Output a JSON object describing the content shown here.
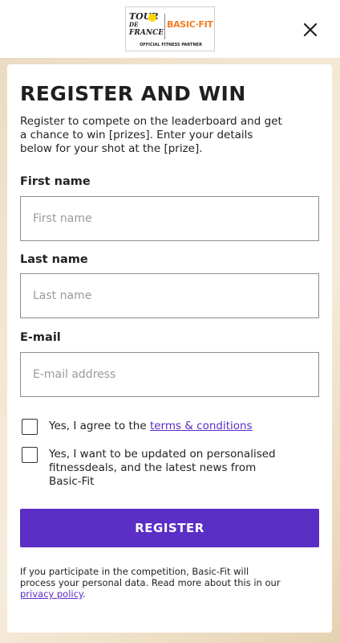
{
  "header": {
    "logo": {
      "tdf_text_1": "TOUR",
      "tdf_text_2": "DE",
      "tdf_text_3": "FRANCE",
      "brand_text": "BASIC·FIT",
      "partner_text": "OFFICIAL FITNESS PARTNER"
    },
    "close_icon": "close-icon"
  },
  "form": {
    "title": "REGISTER AND WIN",
    "intro": "Register to compete on the leaderboard and get a chance to win [prizes]. Enter your details below for your shot at the [prize].",
    "first_name": {
      "label": "First name",
      "placeholder": "First name",
      "value": ""
    },
    "last_name": {
      "label": "Last name",
      "placeholder": "Last name",
      "value": ""
    },
    "email": {
      "label": "E-mail",
      "placeholder": "E-mail address",
      "value": ""
    },
    "terms": {
      "prefix": "Yes, I agree to the ",
      "link_text": "terms & conditions",
      "checked": false
    },
    "updates": {
      "text": "Yes, I want to be updated on personalised fitnessdeals, and the latest news from Basic-Fit",
      "checked": false
    },
    "register_label": "REGISTER",
    "footnote": {
      "text": "If you participate in the competition, Basic-Fit will process your personal data. Read more about this in our ",
      "link_text": "privacy policy",
      "suffix": "."
    }
  },
  "colors": {
    "accent": "#5b2ec6",
    "brand_orange": "#f47c20",
    "background": "#f3e7d3"
  }
}
